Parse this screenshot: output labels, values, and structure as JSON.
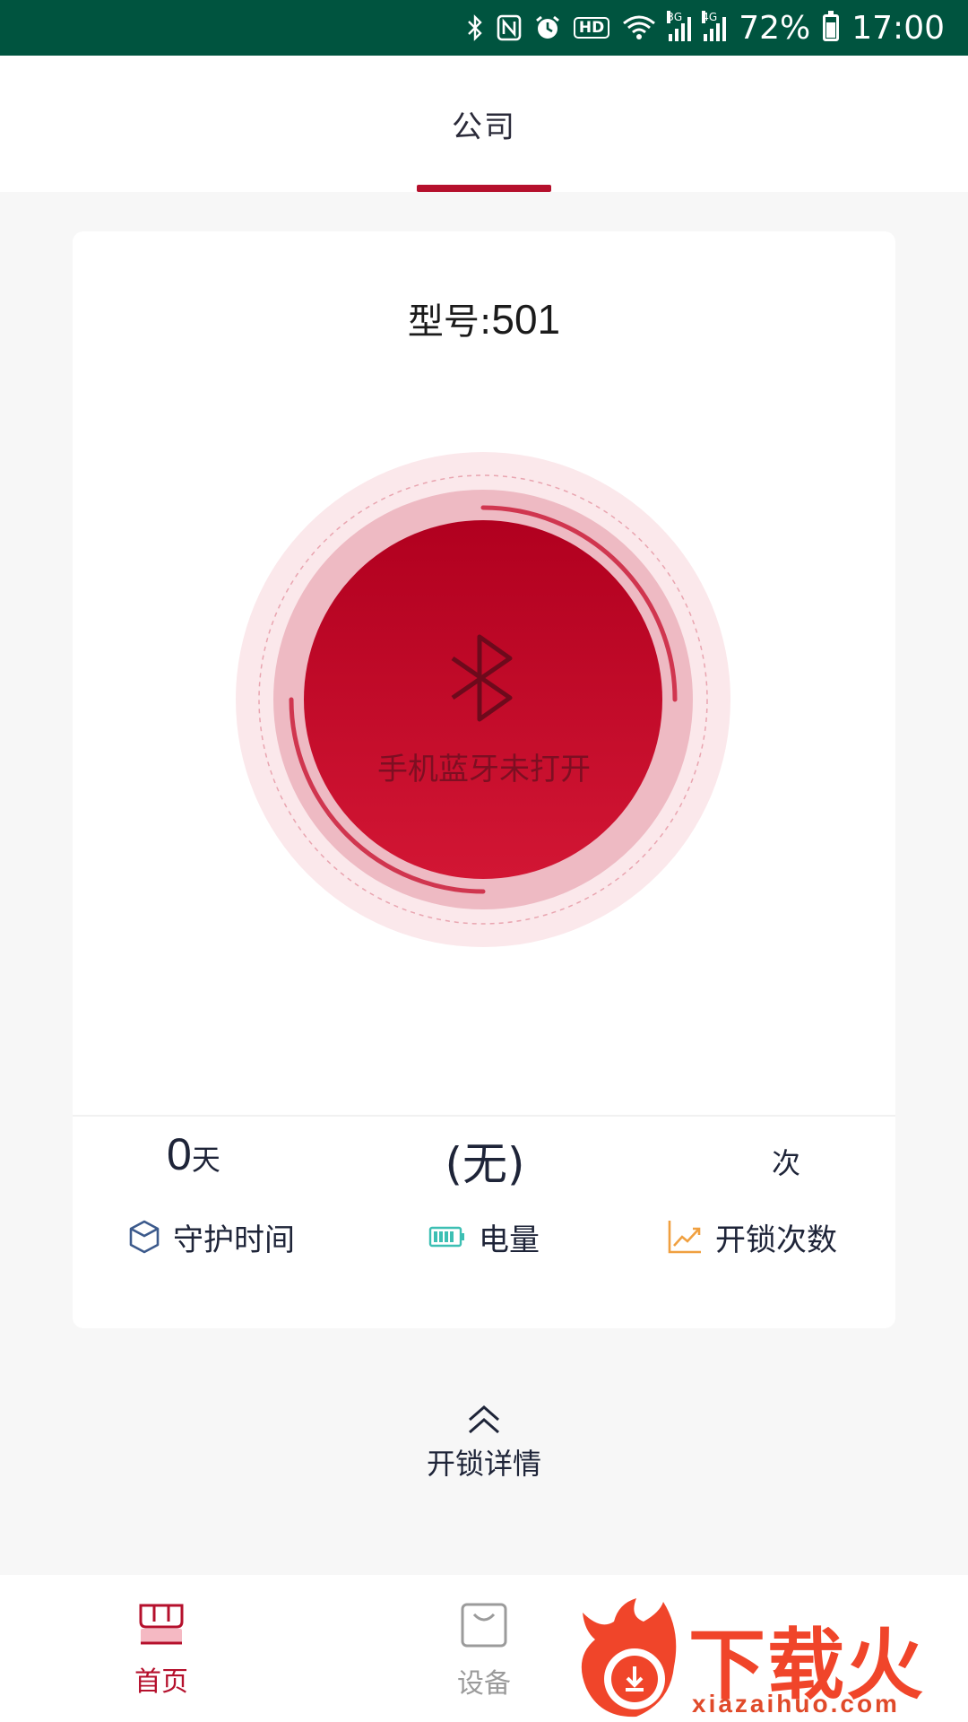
{
  "status_bar": {
    "network_4g": "4G",
    "network_3g": "3G",
    "hd_badge": "HD",
    "battery_percent": "72%",
    "time": "17:00"
  },
  "header": {
    "tab_label": "公司"
  },
  "device_card": {
    "model_label": "型号:",
    "model_value": "501",
    "bluetooth_status": "手机蓝牙未打开",
    "stats": {
      "guard_value": "0",
      "guard_unit": "天",
      "battery_value": "(无)",
      "unlock_unit": "次"
    },
    "labels": {
      "guard": "守护时间",
      "battery": "电量",
      "unlock_count": "开锁次数"
    }
  },
  "details": {
    "label": "开锁详情"
  },
  "bottom_nav": {
    "home": "首页",
    "device": "设备"
  },
  "watermark": {
    "brand": "下载火",
    "url": "xiazaihuo.com"
  },
  "colors": {
    "status_bar": "#00543f",
    "accent": "#b5102c",
    "battery_icon": "#3dbfb3",
    "chart_icon": "#f0a040",
    "guard_icon": "#3c5a8c"
  }
}
